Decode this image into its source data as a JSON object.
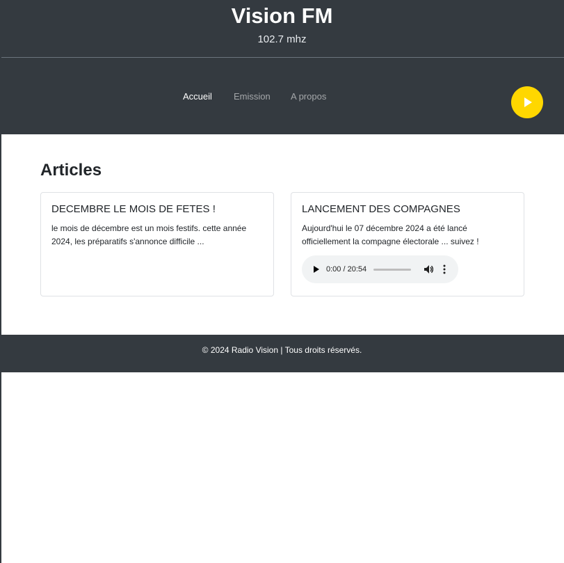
{
  "header": {
    "title": "Vision FM",
    "frequency": "102.7 mhz"
  },
  "nav": {
    "items": [
      {
        "label": "Accueil",
        "active": true
      },
      {
        "label": "Emission",
        "active": false
      },
      {
        "label": "A propos",
        "active": false
      }
    ],
    "play_button_icon": "play-icon",
    "play_button_color": "#ffd700"
  },
  "main": {
    "section_title": "Articles",
    "cards": [
      {
        "title": "DECEMBRE LE MOIS DE FETES !",
        "text": "le mois de décembre est un mois festifs. cette année 2024, les préparatifs s'annonce difficile ..."
      },
      {
        "title": "LANCEMENT DES COMPAGNES",
        "text": "Aujourd'hui le 07 décembre 2024 a été lancé officiellement la compagne électorale ... suivez !",
        "audio": {
          "time": "0:00 / 20:54",
          "progress": 0
        }
      }
    ]
  },
  "footer": {
    "text": "© 2024 Radio Vision | Tous droits réservés."
  },
  "colors": {
    "dark": "#343a40",
    "accent": "#ffd700"
  }
}
